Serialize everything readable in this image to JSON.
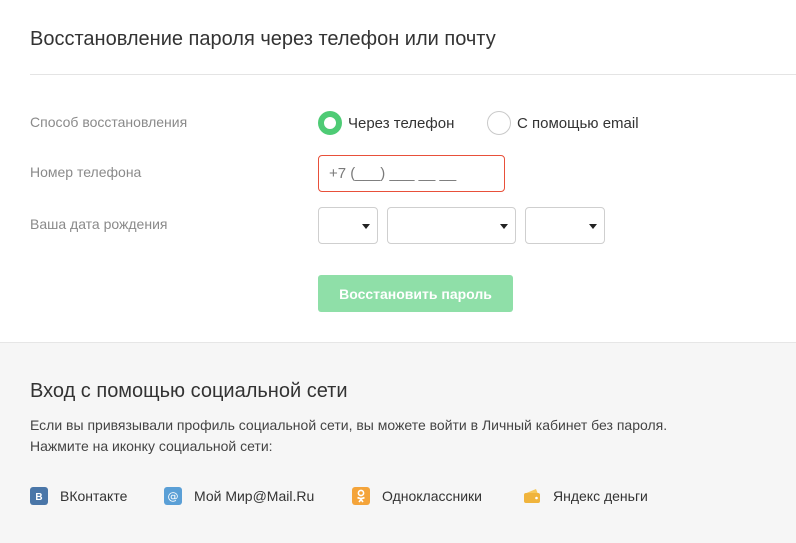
{
  "recovery": {
    "title": "Восстановление пароля через телефон или почту",
    "method_label": "Способ восстановления",
    "method_options": [
      {
        "label": "Через телефон",
        "selected": true
      },
      {
        "label": "С помощью email",
        "selected": false
      }
    ],
    "phone_label": "Номер телефона",
    "phone_placeholder": "+7 (___) ___ __ __",
    "birthdate_label": "Ваша дата рождения",
    "birthdate_selects": [
      {
        "name": "day",
        "value": ""
      },
      {
        "name": "month",
        "value": ""
      },
      {
        "name": "year",
        "value": ""
      }
    ],
    "submit_label": "Восстановить пароль"
  },
  "social": {
    "title": "Вход с помощью социальной сети",
    "description_line1": "Если вы привязывали профиль социальной сети, вы можете войти в Личный кабинет без пароля.",
    "description_line2": "Нажмите на иконку социальной сети:",
    "networks": [
      {
        "label": "ВКонтакте",
        "icon": "vk-icon",
        "color": "#4a76a8"
      },
      {
        "label": "Мой Мир@Mail.Ru",
        "icon": "mail-at-icon",
        "color": "#5a9fd6"
      },
      {
        "label": "Одноклассники",
        "icon": "odnoklassniki-icon",
        "color": "#f4a43a"
      },
      {
        "label": "Яндекс деньги",
        "icon": "yandex-money-wallet-icon",
        "color": "#f0b43c"
      }
    ]
  },
  "colors": {
    "accent_green": "#4ecb75",
    "button_disabled_green": "#8fdfa8",
    "error_red": "#e8503a",
    "social_bg": "#f6f6f6"
  }
}
